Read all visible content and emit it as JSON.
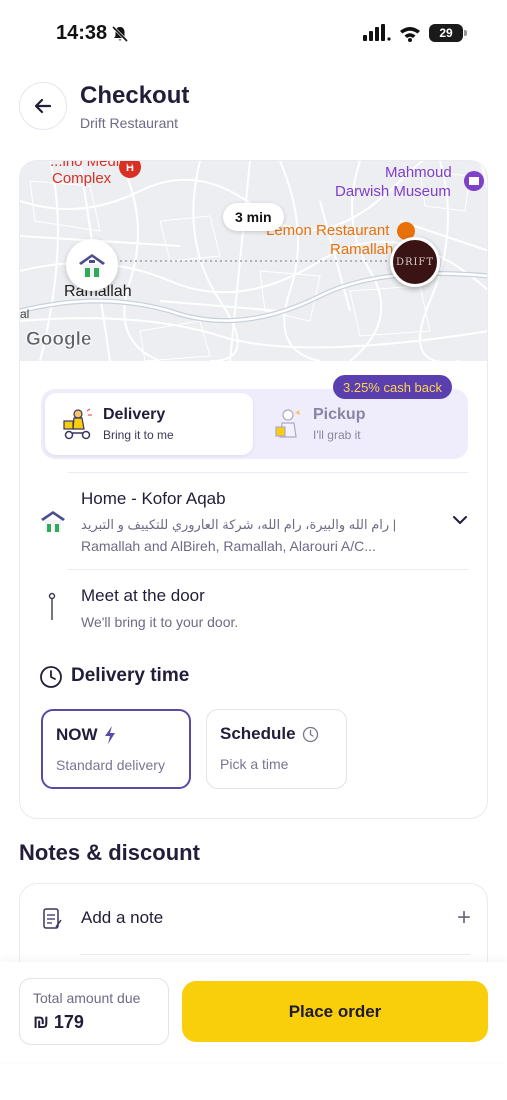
{
  "status_bar": {
    "time": "14:38",
    "battery": "29"
  },
  "header": {
    "title": "Checkout",
    "subtitle": "Drift Restaurant"
  },
  "map": {
    "labels": {
      "medical_top": "...ino Medical",
      "complex": "Complex",
      "museum_1": "Mahmoud",
      "museum_2": "Darwish Museum",
      "lemon_1": "Lemon Restaurant",
      "lemon_2": "Ramallah",
      "city": "Ramallah",
      "edge": "al"
    },
    "eta": "3 min",
    "restaurant_logo": "DRIFT",
    "provider": "Google"
  },
  "delivery_mode": {
    "cashback": "3.25% cash back",
    "delivery": {
      "title": "Delivery",
      "subtitle": "Bring it to me",
      "selected": true
    },
    "pickup": {
      "title": "Pickup",
      "subtitle": "I'll grab it"
    }
  },
  "address": {
    "title": "Home - Kofor Aqab",
    "line_1": "رام الله والبيرة، رام الله، شركة العاروري للتكييف و التبريد |",
    "line_2": "Ramallah and AlBireh, Ramallah, Alarouri A/C..."
  },
  "meet": {
    "title": "Meet at the door",
    "subtitle": "We'll bring it to your door."
  },
  "delivery_time": {
    "title": "Delivery time",
    "now": {
      "title": "NOW",
      "subtitle": "Standard delivery",
      "selected": true
    },
    "schedule": {
      "title": "Schedule",
      "subtitle": "Pick a time"
    }
  },
  "notes": {
    "heading": "Notes & discount",
    "add_note": "Add a note",
    "plus": "+"
  },
  "footer": {
    "total_label": "Total amount due",
    "total_value": "₪ 179",
    "place_order": "Place order"
  },
  "colors": {
    "accent": "#5a4aa5",
    "cta": "#f9cf0b",
    "cashback_bg": "#5a3fb0",
    "cashback_text": "#ffd54a",
    "map_red": "#d93025",
    "map_purple": "#7e3fc9",
    "map_orange": "#e8710a"
  }
}
